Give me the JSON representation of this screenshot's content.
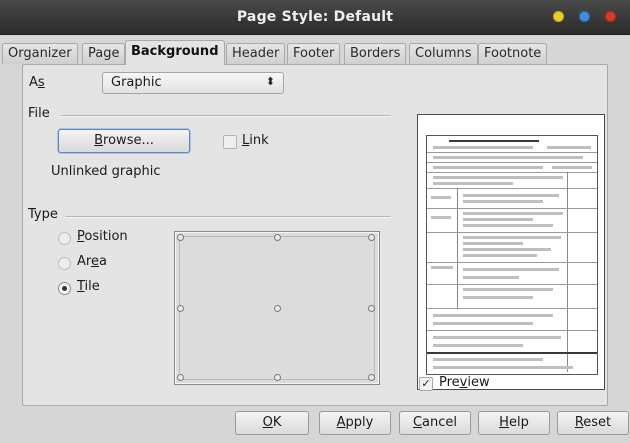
{
  "window": {
    "title": "Page Style: Default"
  },
  "tabs": [
    {
      "label": "Organizer",
      "active": false
    },
    {
      "label": "Page",
      "active": false
    },
    {
      "label": "Background",
      "active": true
    },
    {
      "label": "Header",
      "active": false
    },
    {
      "label": "Footer",
      "active": false
    },
    {
      "label": "Borders",
      "active": false
    },
    {
      "label": "Columns",
      "active": false
    },
    {
      "label": "Footnote",
      "active": false
    }
  ],
  "as": {
    "label_pre": "A",
    "label_mn": "s",
    "value": "Graphic"
  },
  "file": {
    "section_title": "File",
    "browse_mn": "B",
    "browse_rest": "rowse...",
    "link_mn": "L",
    "link_rest": "ink",
    "status": "Unlinked graphic"
  },
  "type": {
    "section_title": "Type",
    "options": [
      {
        "mn": "P",
        "rest": "osition",
        "pre": "",
        "selected": false
      },
      {
        "pre": "Ar",
        "mn": "e",
        "rest": "a",
        "selected": false
      },
      {
        "pre": "",
        "mn": "T",
        "rest": "ile",
        "selected": true
      }
    ]
  },
  "preview": {
    "pre": "Pre",
    "mn": "v",
    "rest": "iew",
    "checked": true,
    "check_glyph": "✓"
  },
  "footer_buttons": [
    {
      "pre": "",
      "mn": "O",
      "rest": "K"
    },
    {
      "pre": "",
      "mn": "A",
      "rest": "pply"
    },
    {
      "pre": "",
      "mn": "C",
      "rest": "ancel"
    },
    {
      "pre": "",
      "mn": "H",
      "rest": "elp"
    },
    {
      "pre": "",
      "mn": "R",
      "rest": "eset"
    }
  ],
  "colors": {
    "titlebar": "#2b2b2b",
    "panel": "#e4e4e4",
    "focus": "#5b86c0"
  },
  "icons": {
    "combo": "spinner-arrows-icon",
    "check": "checkmark-icon"
  }
}
